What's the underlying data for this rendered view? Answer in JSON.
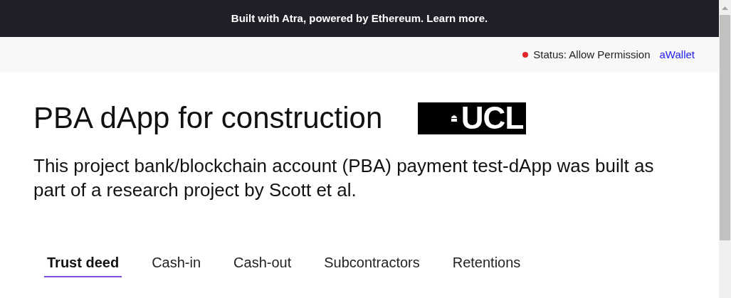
{
  "banner": {
    "text": "Built with Atra, powered by Ethereum. Learn more."
  },
  "status_bar": {
    "status": "Status: Allow Permission",
    "wallet_link": "aWallet"
  },
  "title": "PBA dApp for construction",
  "logo": {
    "text": "UCL"
  },
  "description": "This project bank/blockchain account (PBA) payment test-dApp was built as part of a research project by Scott et al.",
  "tabs": [
    {
      "label": "Trust deed",
      "selected": true
    },
    {
      "label": "Cash-in",
      "selected": false
    },
    {
      "label": "Cash-out",
      "selected": false
    },
    {
      "label": "Subcontractors",
      "selected": false
    },
    {
      "label": "Retentions",
      "selected": false
    }
  ]
}
